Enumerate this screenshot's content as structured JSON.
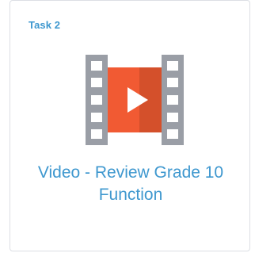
{
  "card": {
    "task_label": "Task 2",
    "title": "Video - Review Grade 10 Function",
    "icon": "video-film-strip-icon"
  },
  "colors": {
    "accent": "#3f98cf",
    "film_frame": "#9a9ea6",
    "film_hole": "#ffffff",
    "screen_left": "#f15a33",
    "screen_right": "#d4502b",
    "play": "#ffffff",
    "border": "#dcdfe4"
  }
}
